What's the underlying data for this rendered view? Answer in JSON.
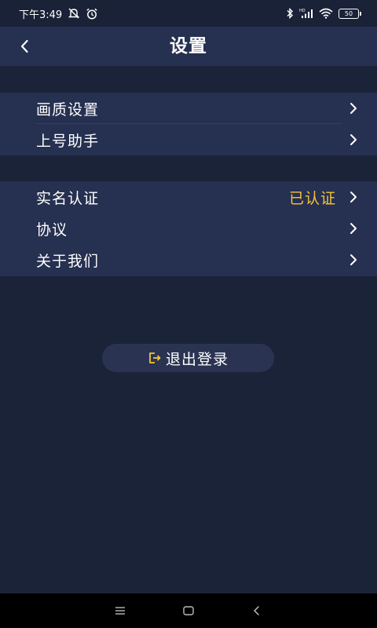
{
  "status_bar": {
    "time": "下午3:49",
    "battery_level": "50",
    "icons": [
      "mute-icon",
      "alarm-icon",
      "bluetooth-icon",
      "signal-icon",
      "wifi-icon",
      "battery-icon"
    ]
  },
  "header": {
    "title": "设置",
    "back_icon": "back-arrow-icon"
  },
  "settings_groups": [
    {
      "items": [
        {
          "label": "画质设置",
          "value": ""
        },
        {
          "label": "上号助手",
          "value": ""
        }
      ]
    },
    {
      "items": [
        {
          "label": "实名认证",
          "value": "已认证"
        },
        {
          "label": "协议",
          "value": ""
        },
        {
          "label": "关于我们",
          "value": ""
        }
      ]
    }
  ],
  "logout": {
    "label": "退出登录",
    "icon": "logout-icon"
  },
  "nav_bar": {
    "icons": [
      "menu-icon",
      "home-icon",
      "back-icon"
    ]
  },
  "colors": {
    "background": "#1b2338",
    "panel": "#263050",
    "accent": "#f6c33b",
    "text": "#ffffff"
  }
}
